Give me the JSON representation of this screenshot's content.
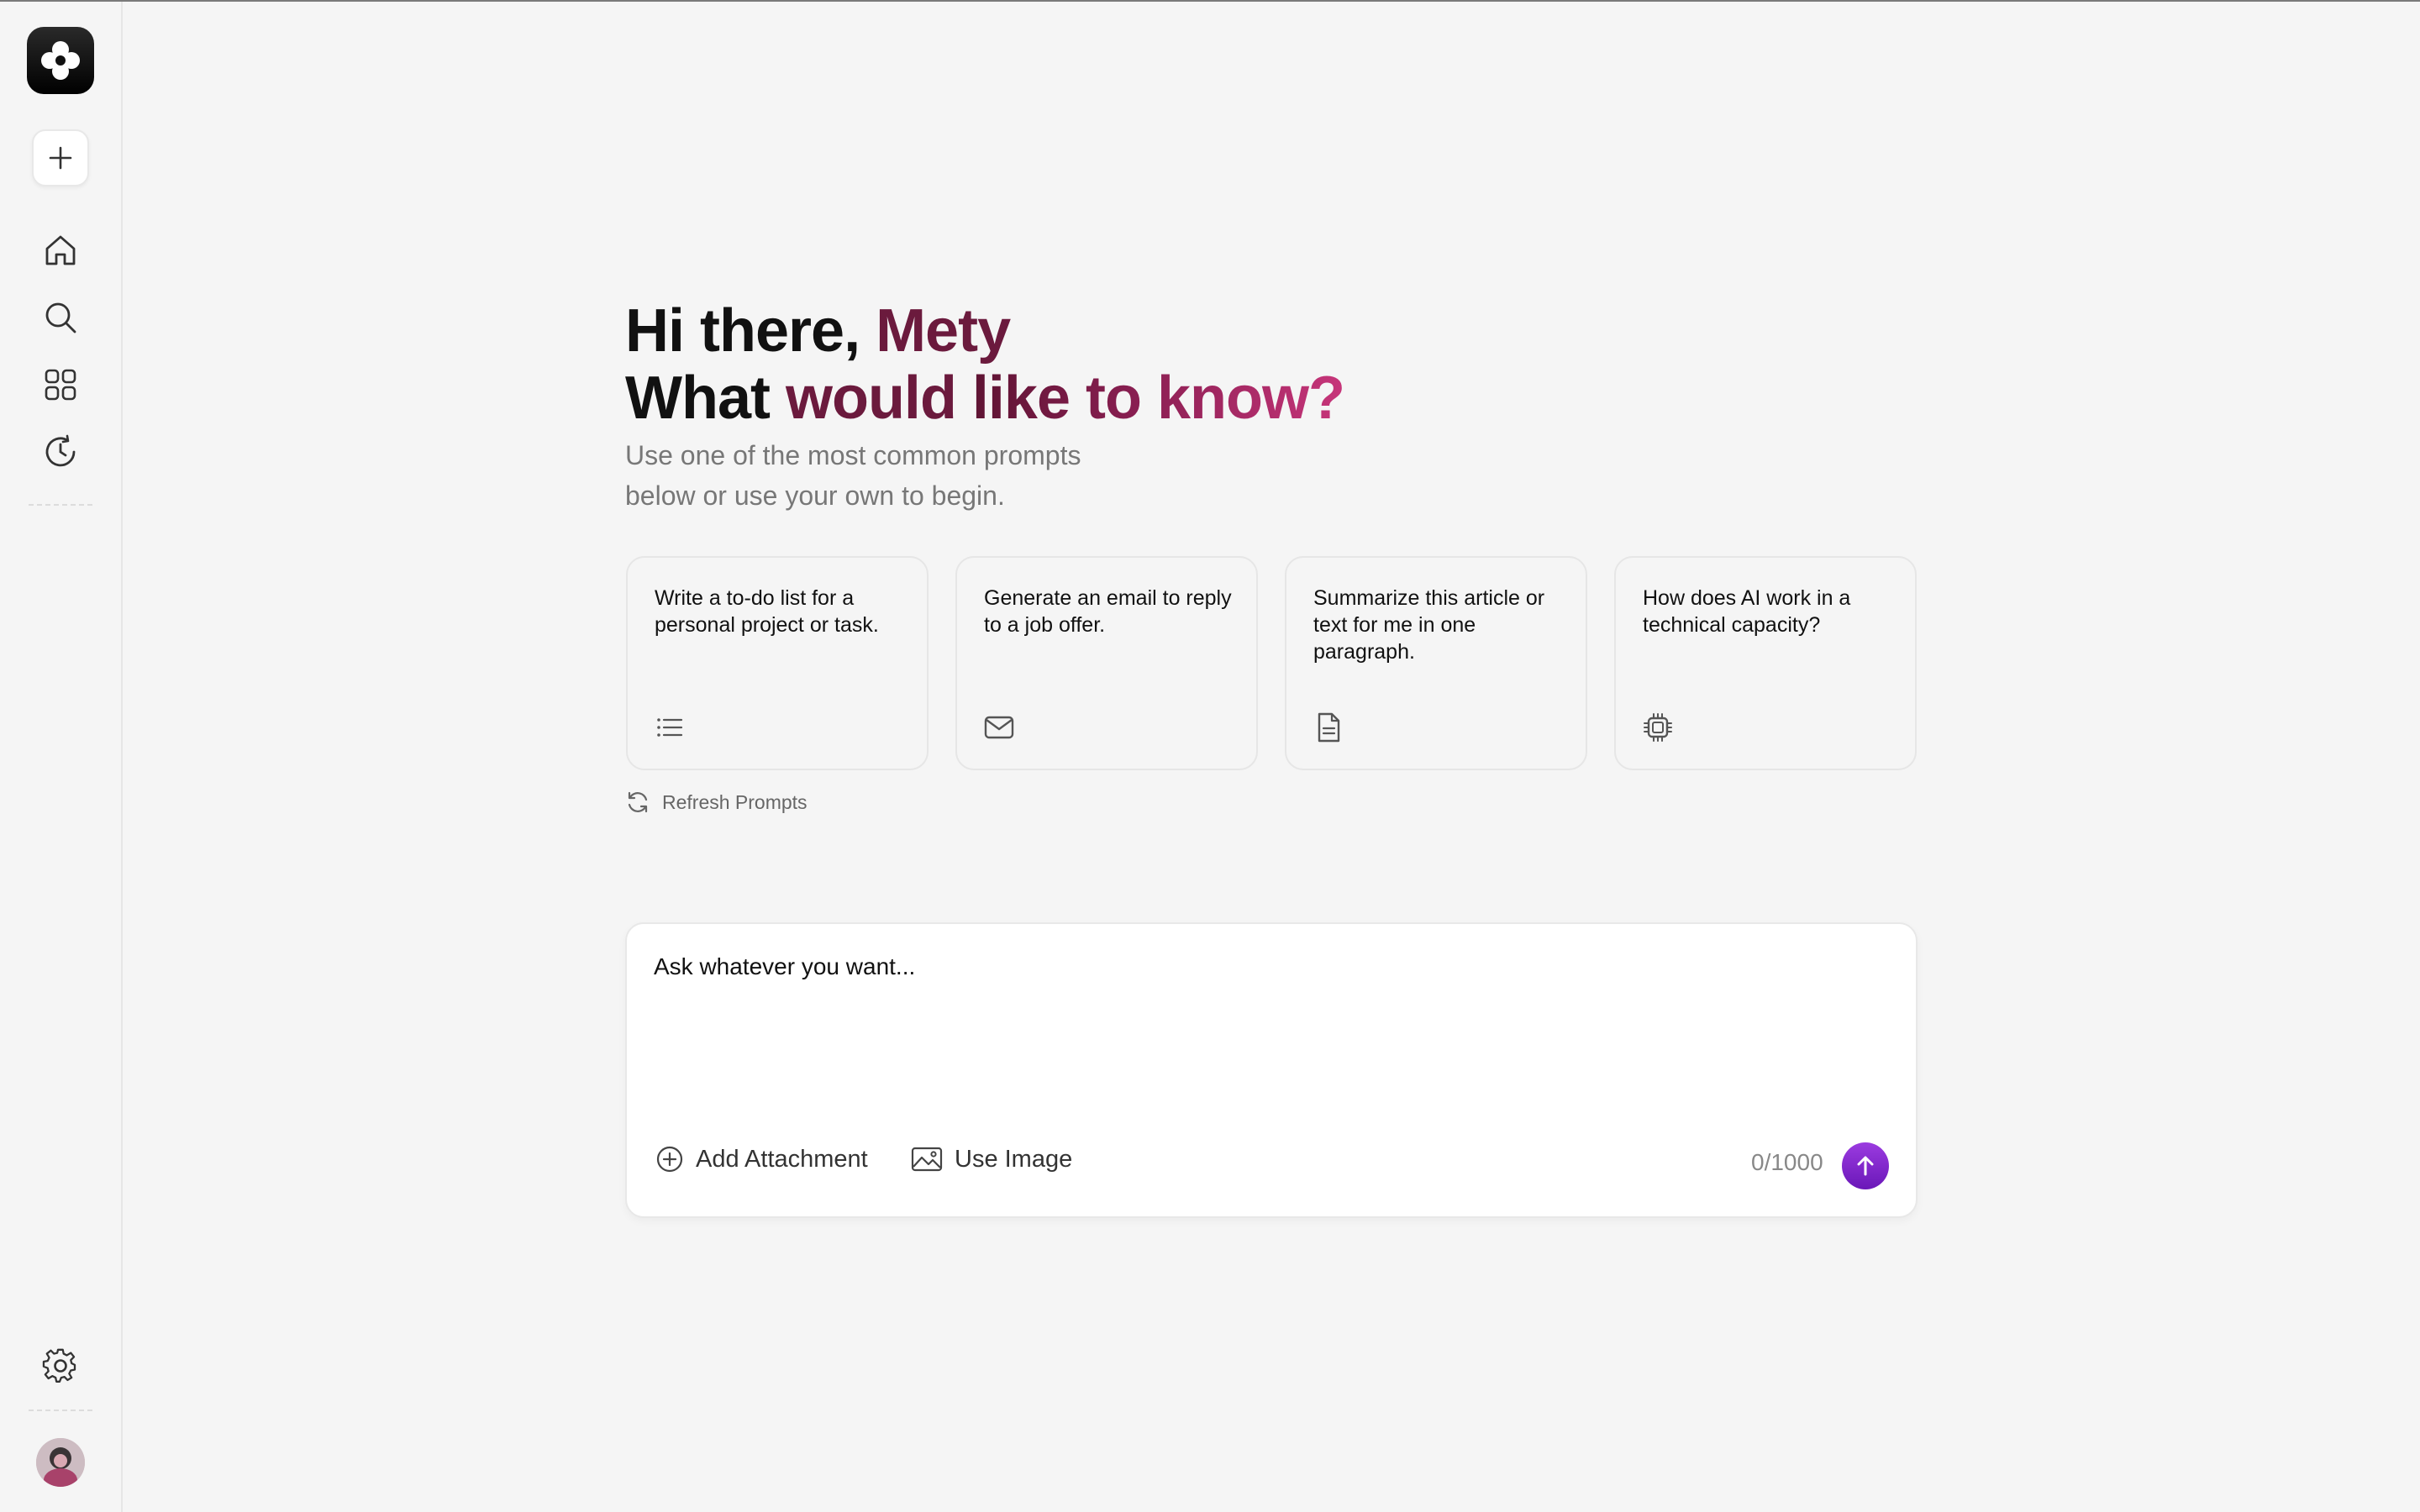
{
  "sidebar": {
    "new_chat_label": "New chat",
    "nav": [
      {
        "icon": "home-icon"
      },
      {
        "icon": "search-icon"
      },
      {
        "icon": "apps-grid-icon"
      },
      {
        "icon": "history-icon"
      }
    ],
    "settings_icon": "gear-icon"
  },
  "main": {
    "greeting_prefix": "Hi there, ",
    "user_name": "Mety",
    "question_what": "What ",
    "question_would": "would ",
    "question_rest": "like to know?",
    "subtitle_line1": "Use one of the most common prompts",
    "subtitle_line2": "below or use your own to begin.",
    "prompts": [
      {
        "text": "Write a to-do list for a personal project or task.",
        "icon": "list-icon"
      },
      {
        "text": "Generate an email to reply to a job offer.",
        "icon": "mail-icon"
      },
      {
        "text": "Summarize this article or text for me in one paragraph.",
        "icon": "document-icon"
      },
      {
        "text": "How does AI work in a technical capacity?",
        "icon": "cpu-chip-icon"
      }
    ],
    "refresh_label": "Refresh Prompts"
  },
  "composer": {
    "placeholder": "Ask whatever you want...",
    "value": "",
    "add_attachment_label": "Add Attachment",
    "use_image_label": "Use Image",
    "counter": "0/1000"
  },
  "colors": {
    "accent_name": "#6b1a3d",
    "accent_gradient_end": "#c7357a",
    "send_button": "#7a22c8"
  }
}
